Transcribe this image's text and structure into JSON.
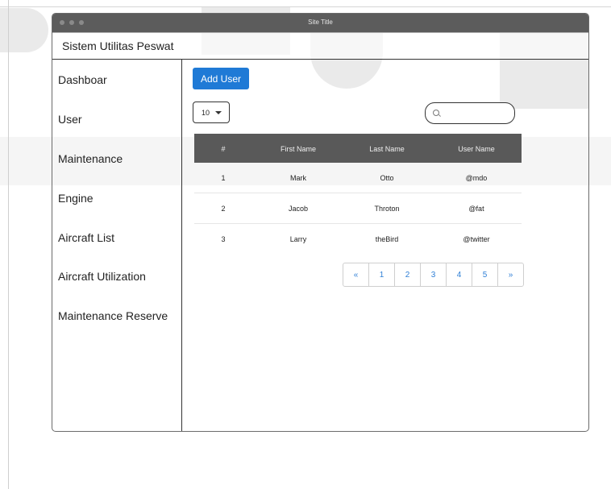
{
  "window": {
    "site_title": "Site Title"
  },
  "app": {
    "title": "Sistem Utilitas Peswat"
  },
  "sidebar": {
    "items": [
      {
        "label": "Dashboar"
      },
      {
        "label": "User"
      },
      {
        "label": "Maintenance"
      },
      {
        "label": "Engine"
      },
      {
        "label": "Aircraft List"
      },
      {
        "label": "Aircraft Utilization"
      },
      {
        "label": "Maintenance Reserve"
      }
    ]
  },
  "toolbar": {
    "add_user_label": "Add User",
    "page_size_value": "10",
    "search_placeholder": ""
  },
  "table": {
    "headers": [
      "#",
      "First Name",
      "Last Name",
      "User Name"
    ],
    "rows": [
      [
        "1",
        "Mark",
        "Otto",
        "@mdo"
      ],
      [
        "2",
        "Jacob",
        "Throton",
        "@fat"
      ],
      [
        "3",
        "Larry",
        "theBird",
        "@twitter"
      ]
    ]
  },
  "pagination": {
    "prev_label": "«",
    "pages": [
      "1",
      "2",
      "3",
      "4",
      "5"
    ],
    "next_label": "»"
  },
  "colors": {
    "accent": "#1f7ad6",
    "table_header": "#595959",
    "titlebar": "#5c5c5c"
  }
}
